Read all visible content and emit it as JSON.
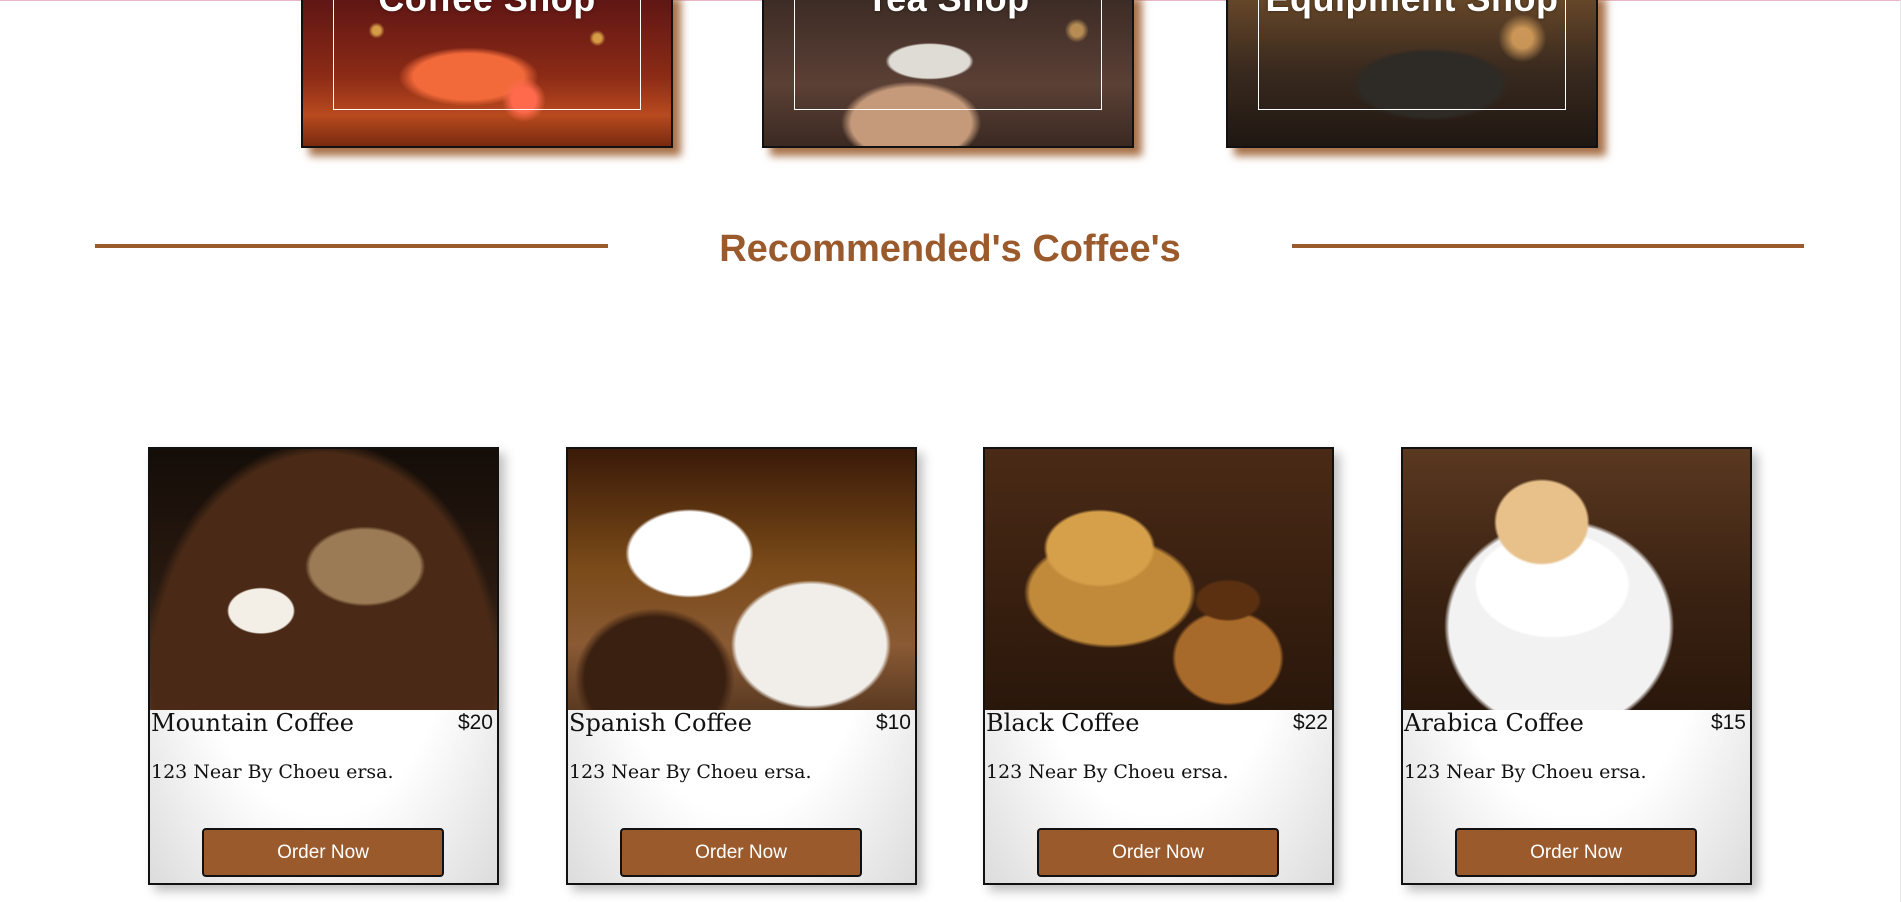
{
  "shops": [
    {
      "label": "Coffee Shop"
    },
    {
      "label": "Tea Shop"
    },
    {
      "label": "Equipment Shop"
    }
  ],
  "section": {
    "title": "Recommended's Coffee's"
  },
  "products": [
    {
      "name": "Mountain Coffee",
      "price": "$20",
      "address": "123 Near By Choeu ersa.",
      "button": "Order Now"
    },
    {
      "name": "Spanish Coffee",
      "price": "$10",
      "address": "123 Near By Choeu ersa.",
      "button": "Order Now"
    },
    {
      "name": "Black Coffee",
      "price": "$22",
      "address": "123 Near By Choeu ersa.",
      "button": "Order Now"
    },
    {
      "name": "Arabica Coffee",
      "price": "$15",
      "address": "123 Near By Choeu ersa.",
      "button": "Order Now"
    }
  ],
  "colors": {
    "accent": "#9a5a2c",
    "button_text": "#ffffff",
    "page_bg": "#ffffff"
  }
}
